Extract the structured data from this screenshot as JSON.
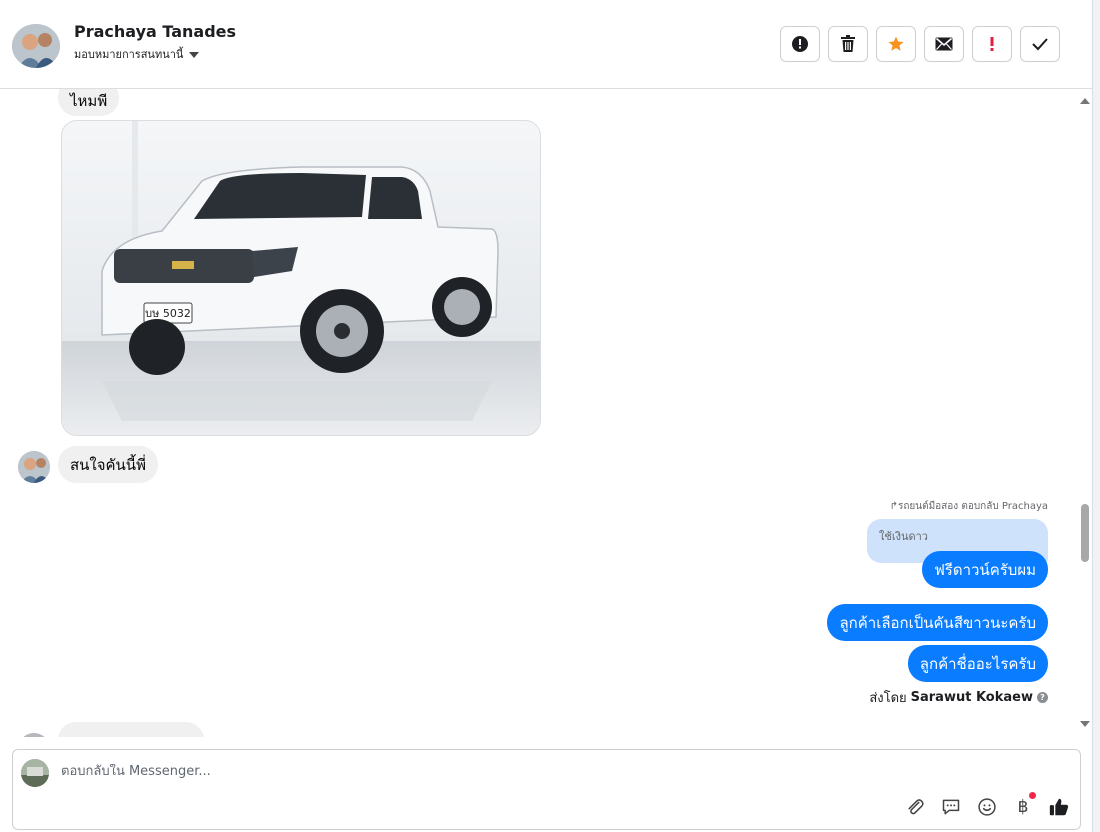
{
  "header": {
    "contact_name": "Prachaya Tanades",
    "assign_label": "มอบหมายการสนทนานี้",
    "actions": [
      {
        "icon": "alert-icon",
        "color": "#1c1e21"
      },
      {
        "icon": "trash-icon",
        "color": "#1c1e21"
      },
      {
        "icon": "star-icon",
        "color": "#f7931e"
      },
      {
        "icon": "envelope-icon",
        "color": "#1c1e21"
      },
      {
        "icon": "exclamation-icon",
        "color": "#e41e3f"
      },
      {
        "icon": "check-icon",
        "color": "#1c1e21"
      }
    ]
  },
  "messages": {
    "incoming_top": "ไหมพี",
    "photo_plate": "บษ 5032",
    "incoming_question": "สนใจคันนี้พี่",
    "reply_meta": "รถยนต์มือสอง ตอบกลับ Prachaya",
    "quoted_text": "ใช้เงินดาว",
    "out_reply": "ฟรีดาวน์ครับผม",
    "out_1": "ลูกค้าเลือกเป็นคันสีขาวนะครับ",
    "out_2": "ลูกค้าชื่ออะไรครับ",
    "sent_by_prefix": "ส่งโดย",
    "sent_by_name": "Sarawut Kokaew"
  },
  "composer": {
    "placeholder": "ตอบกลับใน Messenger...",
    "currency_symbol": "฿"
  },
  "colors": {
    "outgoing_bubble": "#0a7cff",
    "incoming_bubble": "#f0f0f0",
    "quoted_bubble": "#cfe2fb",
    "accent_star": "#f7931e",
    "alert_red": "#e41e3f"
  }
}
